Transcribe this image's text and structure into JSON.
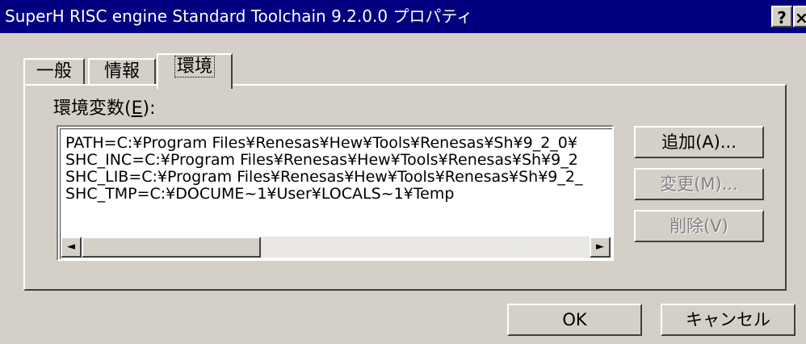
{
  "window": {
    "title": "SuperH RISC engine Standard Toolchain 9.2.0.0 プロパティ",
    "help_button": "?",
    "close_button": "×"
  },
  "tabs": [
    {
      "label": "一般"
    },
    {
      "label": "情報"
    },
    {
      "label": "環境"
    }
  ],
  "env_group": {
    "label": "環境変数(",
    "label_mnemonic": "E",
    "label_suffix": "):"
  },
  "env_list": [
    "PATH=C:¥Program Files¥Renesas¥Hew¥Tools¥Renesas¥Sh¥9_2_0¥",
    "SHC_INC=C:¥Program Files¥Renesas¥Hew¥Tools¥Renesas¥Sh¥9_2",
    "SHC_LIB=C:¥Program Files¥Renesas¥Hew¥Tools¥Renesas¥Sh¥9_2_",
    "SHC_TMP=C:¥DOCUME~1¥User¥LOCALS~1¥Temp"
  ],
  "buttons": {
    "add": "追加(A)...",
    "change": "変更(M)...",
    "delete": "削除(V)",
    "ok": "OK",
    "cancel": "キャンセル"
  },
  "icons": {
    "scroll_left": "◄",
    "scroll_right": "►"
  }
}
